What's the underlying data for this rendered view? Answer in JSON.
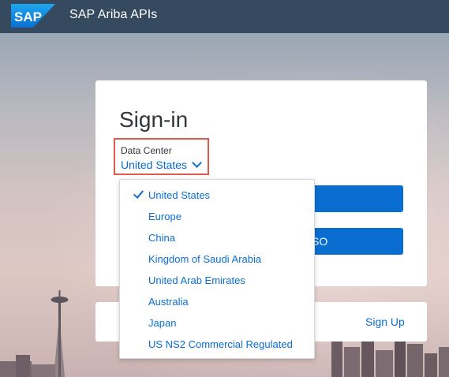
{
  "header": {
    "logo_text": "SAP",
    "title": "SAP Ariba APIs"
  },
  "signin": {
    "title": "Sign-in",
    "data_center_label": "Data Center",
    "data_center_value": "United States",
    "sso_button_tail": "SO"
  },
  "signup": {
    "label": "Sign Up"
  },
  "dropdown": {
    "selected": "United States",
    "options": [
      "United States",
      "Europe",
      "China",
      "Kingdom of Saudi Arabia",
      "United Arab Emirates",
      "Australia",
      "Japan",
      "US NS2 Commercial Regulated"
    ]
  },
  "colors": {
    "header": "#354a5f",
    "accent": "#0a6ed1",
    "highlight_border": "#e05a4b"
  }
}
